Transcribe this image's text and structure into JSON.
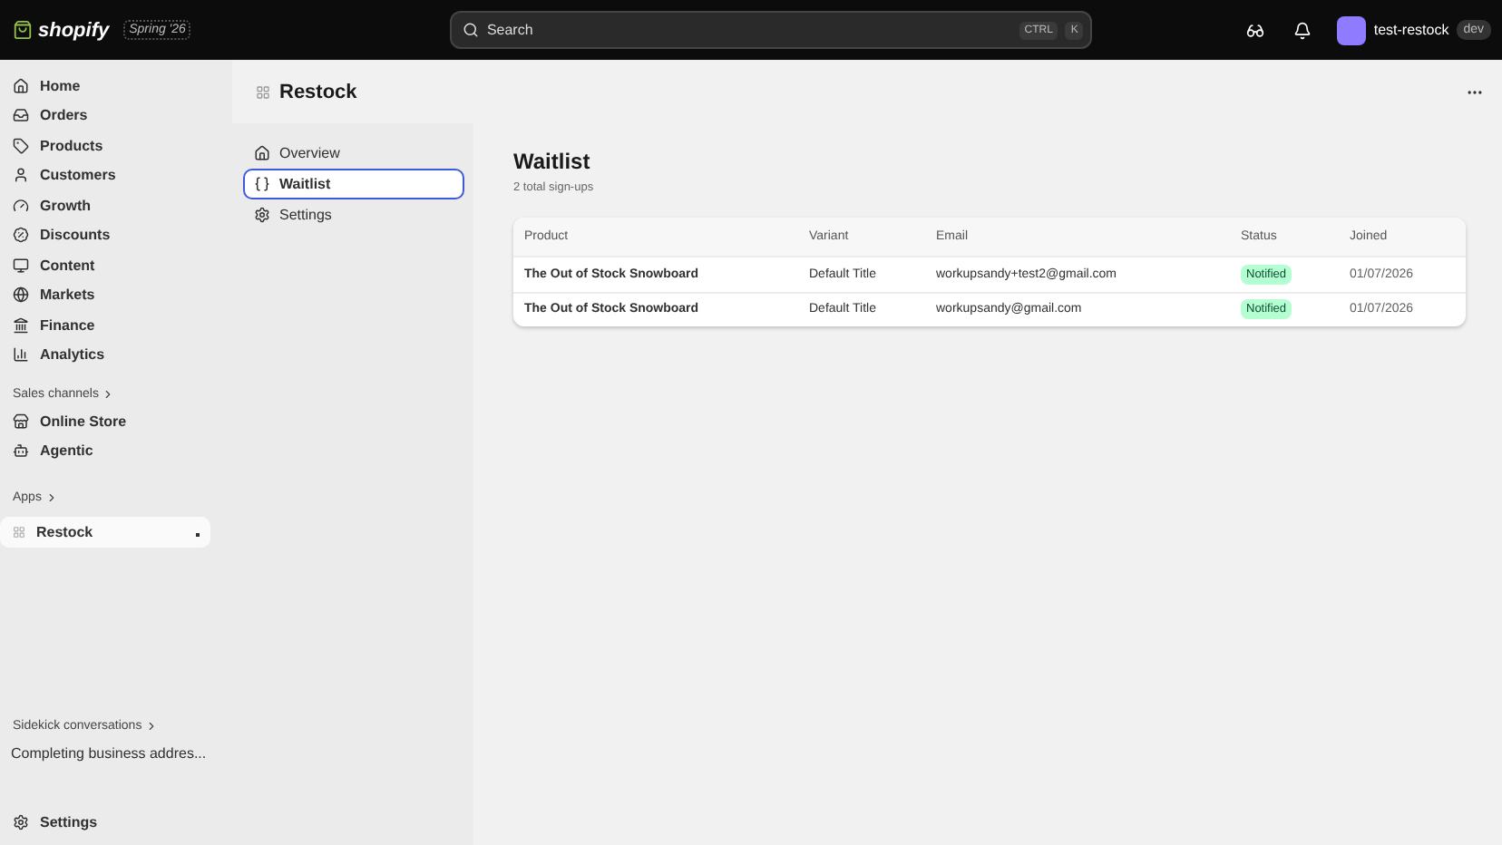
{
  "topbar": {
    "logo": "shopify",
    "edition": "Spring '26",
    "search": {
      "placeholder": "Search",
      "keys": [
        "CTRL",
        "K"
      ]
    },
    "store": "test-restock",
    "store_badge": "dev"
  },
  "sidebar": {
    "main": [
      {
        "label": "Home",
        "selected": false
      },
      {
        "label": "Orders",
        "selected": false
      },
      {
        "label": "Products",
        "selected": false
      },
      {
        "label": "Customers",
        "selected": false
      },
      {
        "label": "Growth",
        "selected": false
      },
      {
        "label": "Discounts",
        "selected": false
      },
      {
        "label": "Content",
        "selected": false
      },
      {
        "label": "Markets",
        "selected": false
      },
      {
        "label": "Finance",
        "selected": false
      },
      {
        "label": "Analytics",
        "selected": false
      }
    ],
    "sales_channels": {
      "label": "Sales channels",
      "items": [
        {
          "label": "Online Store",
          "selected": false
        },
        {
          "label": "Agentic",
          "selected": false
        }
      ]
    },
    "apps": {
      "label": "Apps",
      "items": [
        {
          "label": "Restock",
          "selected": true
        }
      ]
    },
    "sidekick": {
      "label": "Sidekick conversations",
      "items": [
        "Completing business addres..."
      ]
    },
    "settings": "Settings"
  },
  "page": {
    "title": "Restock"
  },
  "subnav": [
    {
      "label": "Overview",
      "selected": false
    },
    {
      "label": "Waitlist",
      "selected": true
    },
    {
      "label": "Settings",
      "selected": false
    }
  ],
  "content": {
    "title": "Waitlist",
    "subtitle": "2 total sign-ups",
    "table": {
      "columns": [
        "Product",
        "Variant",
        "Email",
        "Status",
        "Joined"
      ],
      "rows": [
        [
          "The Out of Stock Snowboard",
          "Default Title",
          "workupsandy+test2@gmail.com",
          "Notified",
          "01/07/2026"
        ],
        [
          "The Out of Stock Snowboard",
          "Default Title",
          "workupsandy@gmail.com",
          "Notified",
          "01/07/2026"
        ]
      ]
    }
  }
}
